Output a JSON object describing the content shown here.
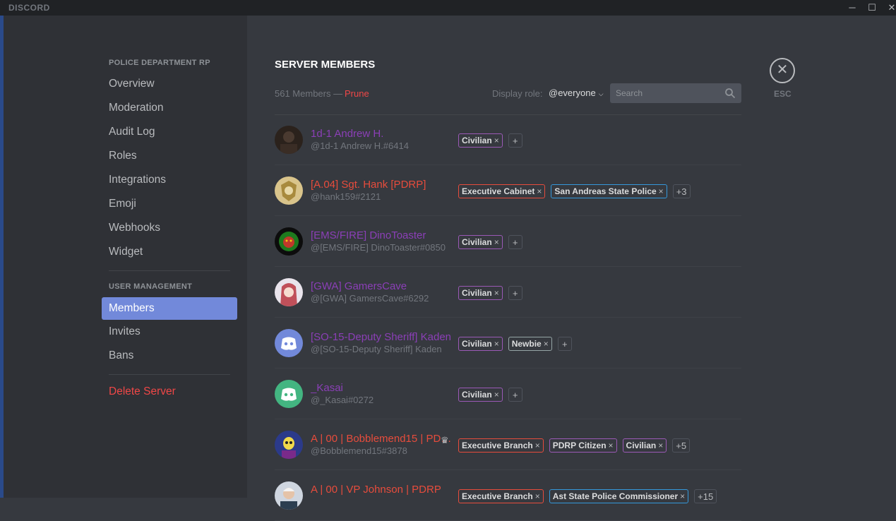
{
  "titlebar": {
    "brand": "DISCORD",
    "min_icon": "─",
    "max_icon": "☐",
    "close_icon": "✕"
  },
  "sidebar": {
    "server_name": "POLICE DEPARTMENT RP",
    "server_items": [
      {
        "label": "Overview"
      },
      {
        "label": "Moderation"
      },
      {
        "label": "Audit Log"
      },
      {
        "label": "Roles"
      },
      {
        "label": "Integrations"
      },
      {
        "label": "Emoji"
      },
      {
        "label": "Webhooks"
      },
      {
        "label": "Widget"
      }
    ],
    "user_mgmt_header": "USER MANAGEMENT",
    "user_items": [
      {
        "label": "Members",
        "selected": true
      },
      {
        "label": "Invites"
      },
      {
        "label": "Bans"
      }
    ],
    "delete_label": "Delete Server"
  },
  "main": {
    "title": "SERVER MEMBERS",
    "member_count": "561 Members —",
    "prune_label": "Prune",
    "display_role_label": "Display role:",
    "display_role_value": "@everyone",
    "search_placeholder": "Search",
    "esc_label": "ESC",
    "close_icon": "✕",
    "chevron_icon": "⌵",
    "plus": "+",
    "remove_icon": "×"
  },
  "members": [
    {
      "name": "1d-1 Andrew H.",
      "tag": "@1d-1 Andrew H.#6414",
      "name_color": "#8b3fb7",
      "avatar": "dark",
      "owner": false,
      "roles": [
        {
          "label": "Civilian",
          "color": "#9b59b6"
        }
      ],
      "more": "+"
    },
    {
      "name": "[A.04] Sgt. Hank [PDRP]",
      "tag": "@hank159#2121",
      "name_color": "#e74c3c",
      "avatar": "badge",
      "owner": false,
      "roles": [
        {
          "label": "Executive Cabinet",
          "color": "#e74c3c"
        },
        {
          "label": "San Andreas State Police",
          "color": "#3498db"
        }
      ],
      "more": "+3"
    },
    {
      "name": "[EMS/FIRE] DinoToaster",
      "tag": "@[EMS/FIRE] DinoToaster#0850",
      "name_color": "#8b3fb7",
      "avatar": "lion",
      "owner": false,
      "roles": [
        {
          "label": "Civilian",
          "color": "#9b59b6"
        }
      ],
      "more": "+"
    },
    {
      "name": "[GWA] GamersCave",
      "tag": "@[GWA] GamersCave#6292",
      "name_color": "#8b3fb7",
      "avatar": "anime",
      "owner": false,
      "roles": [
        {
          "label": "Civilian",
          "color": "#9b59b6"
        }
      ],
      "more": "+"
    },
    {
      "name": "[SO-15-Deputy Sheriff] Kaden",
      "tag": "@[SO-15-Deputy Sheriff] Kaden",
      "name_color": "#8b3fb7",
      "avatar": "discord-blue",
      "owner": false,
      "roles": [
        {
          "label": "Civilian",
          "color": "#9b59b6"
        },
        {
          "label": "Newbie",
          "color": "#95a5a6"
        }
      ],
      "more": "+"
    },
    {
      "name": "_Kasai",
      "tag": "@_Kasai#0272",
      "name_color": "#8b3fb7",
      "avatar": "discord-green",
      "owner": false,
      "roles": [
        {
          "label": "Civilian",
          "color": "#9b59b6"
        }
      ],
      "more": "+"
    },
    {
      "name": "A | 00 | Bobblemend15 | PDRP",
      "tag": "@Bobblemend15#3878",
      "name_color": "#e74c3c",
      "avatar": "skeletor",
      "owner": true,
      "roles": [
        {
          "label": "Executive Branch",
          "color": "#e74c3c"
        },
        {
          "label": "PDRP Citizen",
          "color": "#9b59b6"
        },
        {
          "label": "Civilian",
          "color": "#9b59b6"
        }
      ],
      "more": "+5"
    },
    {
      "name": "A | 00 | VP Johnson | PDRP",
      "tag": "",
      "name_color": "#e74c3c",
      "avatar": "person",
      "owner": false,
      "roles": [
        {
          "label": "Executive Branch",
          "color": "#e74c3c"
        },
        {
          "label": "Ast State Police Commissioner",
          "color": "#3498db"
        }
      ],
      "more": "+15"
    }
  ]
}
